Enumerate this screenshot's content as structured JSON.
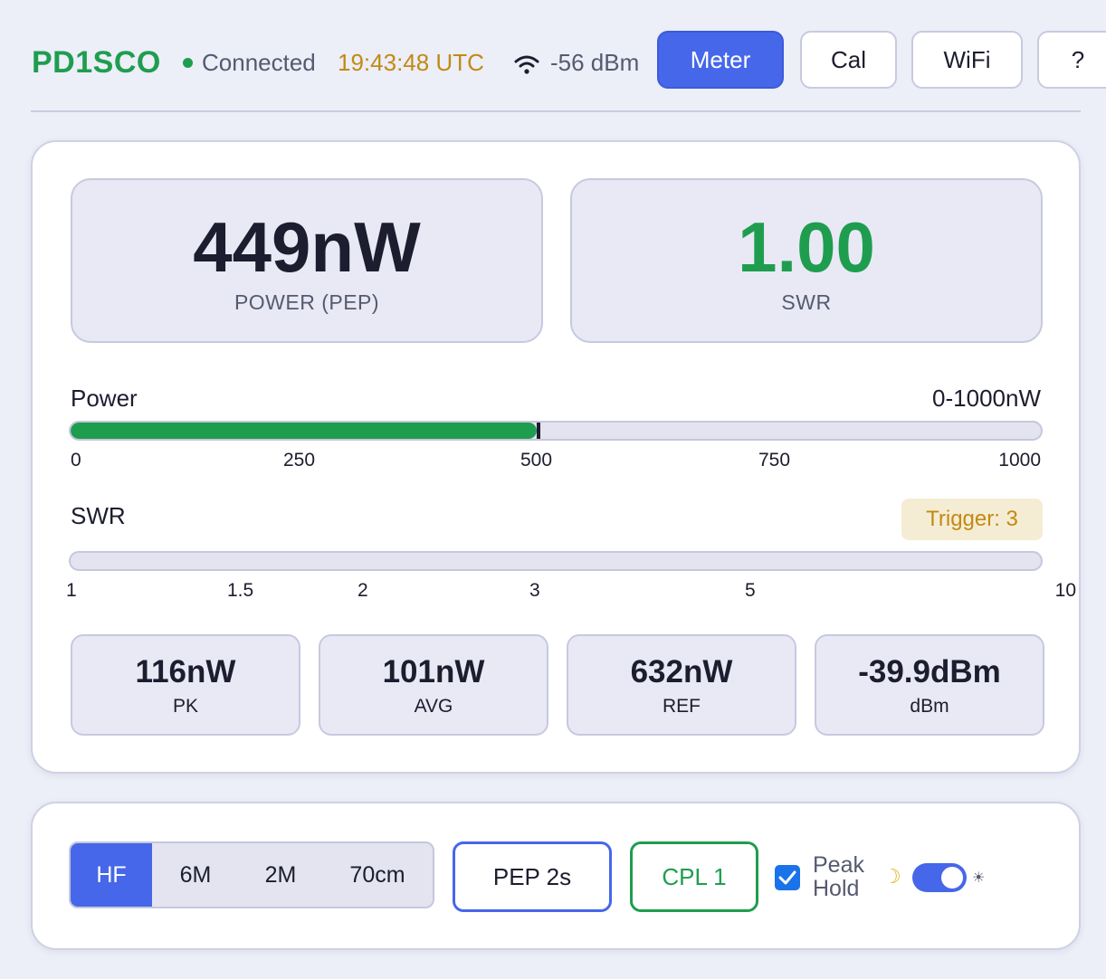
{
  "header": {
    "callsign": "PD1SCO",
    "status": "Connected",
    "time": "19:43:48 UTC",
    "rssi": "-56 dBm",
    "nav": [
      {
        "label": "Meter",
        "active": true
      },
      {
        "label": "Cal",
        "active": false
      },
      {
        "label": "WiFi",
        "active": false
      },
      {
        "label": "?",
        "active": false
      }
    ]
  },
  "meter": {
    "power_value": "449nW",
    "power_label": "POWER (PEP)",
    "swr_value": "1.00",
    "swr_label": "SWR",
    "power_bar": {
      "label": "Power",
      "range": "0-1000nW",
      "fill_fraction": 0.449,
      "ticks": [
        "0",
        "250",
        "500",
        "750",
        "1000"
      ]
    },
    "swr_bar": {
      "label": "SWR",
      "trigger": "Trigger: 3",
      "fill_fraction": 0.0,
      "ticks": [
        "1",
        "1.5",
        "2",
        "3",
        "5",
        "10"
      ]
    },
    "stats": [
      {
        "value": "116nW",
        "label": "PK"
      },
      {
        "value": "101nW",
        "label": "AVG"
      },
      {
        "value": "632nW",
        "label": "REF"
      },
      {
        "value": "-39.9dBm",
        "label": "dBm"
      }
    ]
  },
  "controls": {
    "bands": [
      {
        "label": "HF",
        "active": true
      },
      {
        "label": "6M",
        "active": false
      },
      {
        "label": "2M",
        "active": false
      },
      {
        "label": "70cm",
        "active": false
      }
    ],
    "pep_mode": "PEP 2s",
    "coupler": "CPL 1",
    "peak_hold_line1": "Peak",
    "peak_hold_line2": "Hold",
    "peak_hold_checked": true,
    "moon_glyph": "☽",
    "sun_glyph": "☀",
    "theme_toggle_on": true
  },
  "colors": {
    "accent": "#4667ea",
    "green": "#1f9d4f",
    "amber": "#c28a14"
  }
}
